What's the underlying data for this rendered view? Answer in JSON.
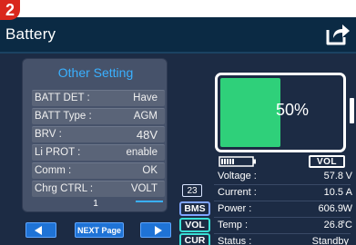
{
  "step_badge": "2",
  "header": {
    "title": "Battery"
  },
  "settings_panel": {
    "title": "Other Setting",
    "rows": [
      {
        "label": "BATT DET :",
        "value": "Have"
      },
      {
        "label": "BATT Type :",
        "value": "AGM"
      },
      {
        "label": "BRV :",
        "value": "48V"
      },
      {
        "label": "Li PROT :",
        "value": "enable"
      },
      {
        "label": "Comm :",
        "value": "OK"
      },
      {
        "label": "Chrg CTRL :",
        "value": "VOLT"
      }
    ],
    "page_number": "1"
  },
  "nav": {
    "next_page_label": "NEXT Page"
  },
  "battery": {
    "percent_label": "50%",
    "level": 0.5,
    "fill_color": "#2fd07a"
  },
  "mode_badge": "VOL",
  "status": {
    "count": "23",
    "tags": {
      "bms": "BMS",
      "vol": "VOL",
      "cur": "CUR"
    },
    "rows": [
      {
        "label": "Voltage :",
        "value": "57.8",
        "unit": "V"
      },
      {
        "label": "Current :",
        "value": "10.5",
        "unit": "A"
      },
      {
        "label": "Power :",
        "value": "606.9",
        "unit": "W"
      },
      {
        "label": "Temp :",
        "value": "26.8",
        "unit": "°C"
      },
      {
        "label": "Status :",
        "value": "Standby",
        "unit": ""
      }
    ]
  },
  "colors": {
    "accent_blue": "#3ab0ff",
    "background": "#1c2b44",
    "header": "#0b2a44",
    "badge_red": "#d9271c"
  }
}
